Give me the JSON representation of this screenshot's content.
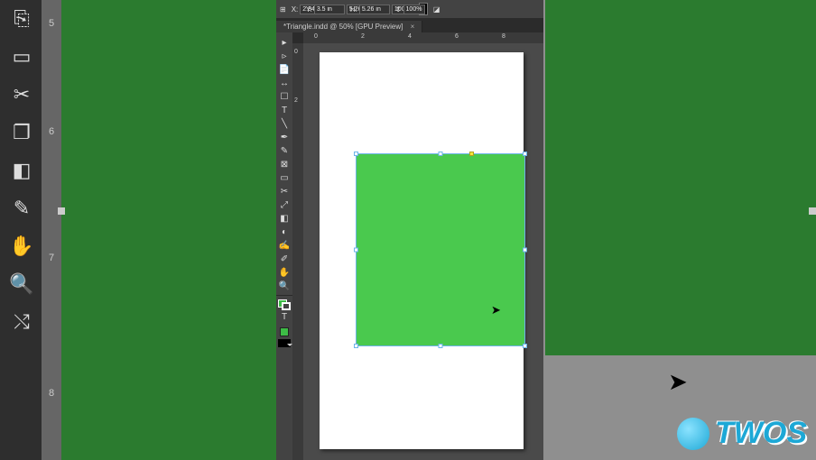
{
  "bg_ruler": {
    "m5": "5",
    "m6": "6",
    "m7": "7",
    "m8": "8"
  },
  "controlBar": {
    "xLabel": "X:",
    "xVal": "2.84 in",
    "yLabel": "Y:",
    "yVal": "3.5 in",
    "wLabel": "W:",
    "wVal": "5.26 in",
    "hLabel": "H:",
    "hVal": "5.26 in",
    "sxVal": "100%",
    "syVal": "100%"
  },
  "tab": {
    "title": "*Triangle.indd @ 50% [GPU Preview]",
    "close": "×"
  },
  "rulerH": {
    "m0": "0",
    "m2": "2",
    "m4": "4",
    "m6": "6",
    "m8": "8"
  },
  "rulerV": {
    "m0": "0",
    "m2": "2"
  },
  "watermark": {
    "text": "TWOS"
  }
}
